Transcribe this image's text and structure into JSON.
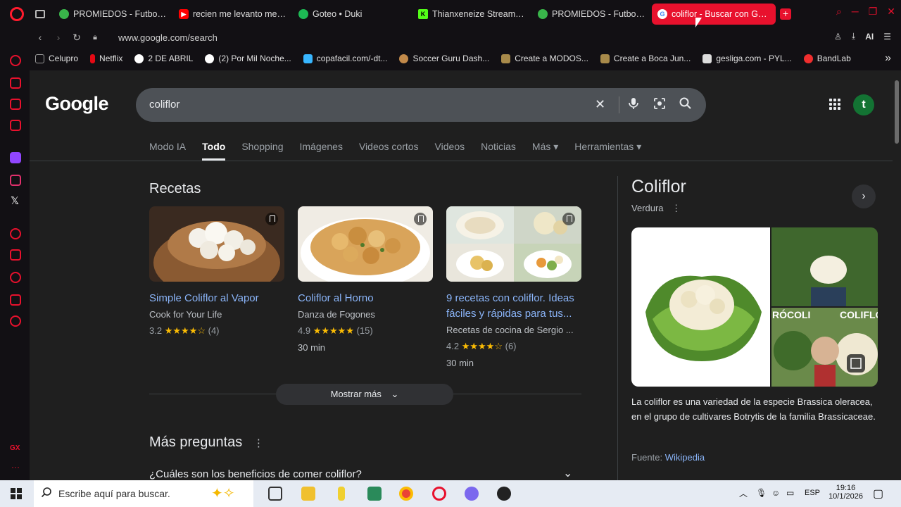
{
  "browser": {
    "tabs": [
      {
        "label": "PROMIEDOS - Futbol Arg",
        "icon": "promiedos-icon",
        "color": "#39b54a"
      },
      {
        "label": "recien me levanto me sal",
        "icon": "youtube-icon",
        "color": "#ff0000"
      },
      {
        "label": "Goteo • Duki",
        "icon": "spotify-icon",
        "color": "#1db954"
      },
      {
        "label": "Thianxeneize Stream - K",
        "icon": "kick-icon",
        "color": "#53fc18"
      },
      {
        "label": "PROMIEDOS - Futbol Arg",
        "icon": "promiedos-icon",
        "color": "#39b54a"
      },
      {
        "label": "coliflor - Buscar con Goog",
        "icon": "google-icon",
        "color": "#ffffff"
      }
    ],
    "new_tab": "+",
    "url": "www.google.com/search",
    "ai_label": "AI",
    "bookmarks": [
      {
        "label": "Celupro",
        "color": "#999999"
      },
      {
        "label": "Netflix",
        "color": "#e50914"
      },
      {
        "label": "2 DE ABRIL",
        "color": "#ffffff"
      },
      {
        "label": "(2) Por Mil Noche...",
        "color": "#ffffff"
      },
      {
        "label": "copafacil.com/-dt...",
        "color": "#38b6ff"
      },
      {
        "label": "Soccer Guru Dash...",
        "color": "#c28a4a"
      },
      {
        "label": "Create a MODOS...",
        "color": "#a88a4a"
      },
      {
        "label": "Create a Boca Jun...",
        "color": "#a88a4a"
      },
      {
        "label": "gesliga.com - PYL...",
        "color": "#dddddd"
      },
      {
        "label": "BandLab",
        "color": "#f02e2e"
      }
    ]
  },
  "google": {
    "logo": "Google",
    "query": "coliflor",
    "nav_tabs": [
      "Modo IA",
      "Todo",
      "Shopping",
      "Imágenes",
      "Videos cortos",
      "Videos",
      "Noticias",
      "Más ▾",
      "Herramientas ▾"
    ],
    "recipes_title": "Recetas",
    "recipes": [
      {
        "title": "Simple Coliflor al Vapor",
        "source": "Cook for Your Life",
        "rating": "3.2",
        "stars": "★★★★☆",
        "count": "(4)",
        "time": ""
      },
      {
        "title": "Coliflor al Horno",
        "source": "Danza de Fogones",
        "rating": "4.9",
        "stars": "★★★★★",
        "count": "(15)",
        "time": "30 min"
      },
      {
        "title": "9 recetas con coliflor. Ideas fáciles y rápidas para tus...",
        "source": "Recetas de cocina de Sergio ...",
        "rating": "4.2",
        "stars": "★★★★☆",
        "count": "(6)",
        "time": "30 min"
      }
    ],
    "show_more": "Mostrar más",
    "questions_title": "Más preguntas",
    "question_1": "¿Cuáles son los beneficios de comer coliflor?",
    "avatar_letter": "t",
    "knowledge_panel": {
      "title": "Coliflor",
      "subtitle": "Verdura",
      "image_label_1": "RÓCOLI",
      "image_label_2": "COLIFLO",
      "description": "La coliflor es una variedad de la especie Brassica oleracea, en el grupo de cultivares Botrytis de la familia Brassicaceae.",
      "source_label": "Fuente:",
      "source_link": "Wikipedia"
    }
  },
  "taskbar": {
    "search_placeholder": "Escribe aquí para buscar.",
    "language": "ESP",
    "time": "19:16",
    "date": "10/1/2026"
  }
}
